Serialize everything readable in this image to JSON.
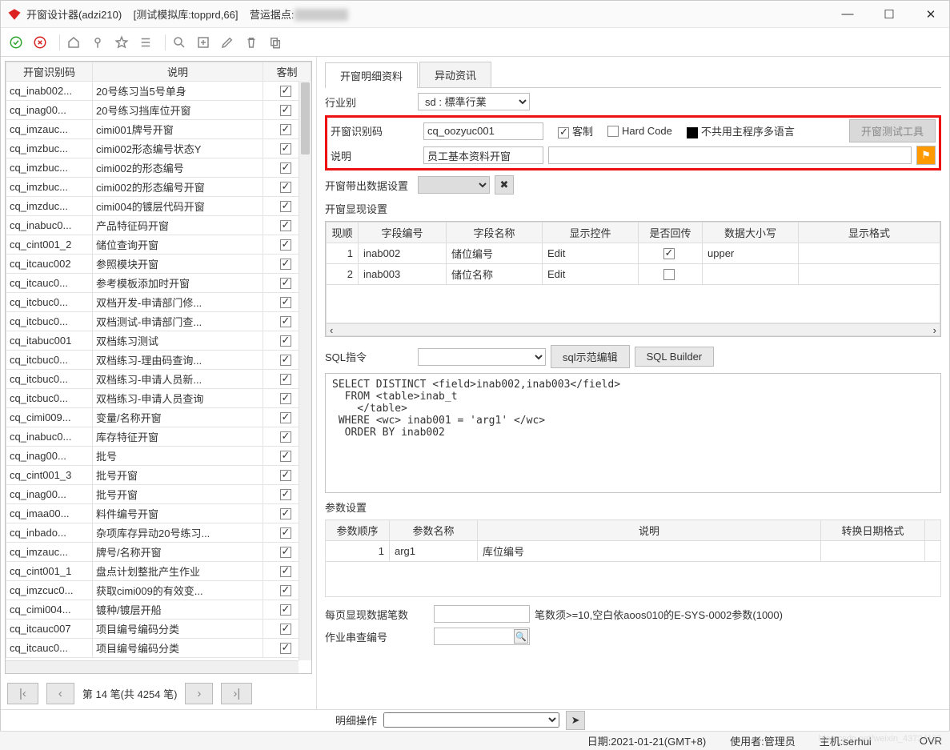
{
  "title": {
    "app": "开窗设计器(adzi210)",
    "env": "[测试模拟库:topprd,66]",
    "site_label": "营运据点:",
    "site_value": "██████"
  },
  "win_controls": {
    "min": "—",
    "max": "☐",
    "close": "✕"
  },
  "left_headers": {
    "code": "开窗识别码",
    "desc": "说明",
    "cust": "客制"
  },
  "left_rows": [
    {
      "code": "cq_inab002...",
      "desc": "20号练习当5号单身",
      "chk": true
    },
    {
      "code": "cq_inag00...",
      "desc": "20号练习挡库位开窗",
      "chk": true
    },
    {
      "code": "cq_imzauc...",
      "desc": "cimi001牌号开窗",
      "chk": true
    },
    {
      "code": "cq_imzbuc...",
      "desc": "cimi002形态编号状态Y",
      "chk": true
    },
    {
      "code": "cq_imzbuc...",
      "desc": "cimi002的形态编号",
      "chk": true
    },
    {
      "code": "cq_imzbuc...",
      "desc": "cimi002的形态编号开窗",
      "chk": true
    },
    {
      "code": "cq_imzduc...",
      "desc": "cimi004的镀层代码开窗",
      "chk": true
    },
    {
      "code": "cq_inabuc0...",
      "desc": "产品特征码开窗",
      "chk": true
    },
    {
      "code": "cq_cint001_2",
      "desc": "储位查询开窗",
      "chk": true
    },
    {
      "code": "cq_itcauc002",
      "desc": "参照模块开窗",
      "chk": true
    },
    {
      "code": "cq_itcauc0...",
      "desc": "参考模板添加时开窗",
      "chk": true
    },
    {
      "code": "cq_itcbuc0...",
      "desc": "双档开发-申请部门修...",
      "chk": true
    },
    {
      "code": "cq_itcbuc0...",
      "desc": "双档测试-申请部门查...",
      "chk": true
    },
    {
      "code": "cq_itabuc001",
      "desc": "双档练习测试",
      "chk": true
    },
    {
      "code": "cq_itcbuc0...",
      "desc": "双档练习-理由码查询...",
      "chk": true
    },
    {
      "code": "cq_itcbuc0...",
      "desc": "双档练习-申请人员新...",
      "chk": true
    },
    {
      "code": "cq_itcbuc0...",
      "desc": "双档练习-申请人员查询",
      "chk": true
    },
    {
      "code": "cq_cimi009...",
      "desc": "变量/名称开窗",
      "chk": true
    },
    {
      "code": "cq_inabuc0...",
      "desc": "库存特征开窗",
      "chk": true
    },
    {
      "code": "cq_inag00...",
      "desc": "批号",
      "chk": true
    },
    {
      "code": "cq_cint001_3",
      "desc": "批号开窗",
      "chk": true
    },
    {
      "code": "cq_inag00...",
      "desc": "批号开窗",
      "chk": true
    },
    {
      "code": "cq_imaa00...",
      "desc": "料件编号开窗",
      "chk": true
    },
    {
      "code": "cq_inbado...",
      "desc": "杂项库存异动20号练习...",
      "chk": true
    },
    {
      "code": "cq_imzauc...",
      "desc": "牌号/名称开窗",
      "chk": true
    },
    {
      "code": "cq_cint001_1",
      "desc": "盘点计划整批产生作业",
      "chk": true
    },
    {
      "code": "cq_imzcuc0...",
      "desc": "获取cimi009的有效变...",
      "chk": true
    },
    {
      "code": "cq_cimi004...",
      "desc": "镀种/镀层开船",
      "chk": true
    },
    {
      "code": "cq_itcauc007",
      "desc": "项目编号编码分类",
      "chk": true
    },
    {
      "code": "cq_itcauc0...",
      "desc": "项目编号编码分类",
      "chk": true
    }
  ],
  "pager": {
    "text": "第 14 笔(共 4254 笔)",
    "first": "|‹",
    "prev": "‹",
    "next": "›",
    "last": "›|"
  },
  "tabs": {
    "tab1": "开窗明细资料",
    "tab2": "异动资讯"
  },
  "form": {
    "industry_label": "行业别",
    "industry_value": "sd : 標準行業",
    "id_label": "开窗识别码",
    "id_value": "cq_oozyuc001",
    "cust_label": "客制",
    "hardcode_label": "Hard Code",
    "nolang_label": "不共用主程序多语言",
    "test_btn": "开窗测试工具",
    "desc_label": "说明",
    "desc_value": "员工基本资料开窗",
    "export_cfg_label": "开窗带出数据设置",
    "display_cfg_label": "开窗显现设置"
  },
  "field_grid": {
    "headers": {
      "order": "现顺",
      "code": "字段编号",
      "name": "字段名称",
      "widget": "显示控件",
      "return": "是否回传",
      "case": "数据大小写",
      "fmt": "显示格式"
    },
    "rows": [
      {
        "order": "1",
        "code": "inab002",
        "name": "储位编号",
        "widget": "Edit",
        "return": true,
        "case": "upper",
        "fmt": ""
      },
      {
        "order": "2",
        "code": "inab003",
        "name": "储位名称",
        "widget": "Edit",
        "return": false,
        "case": "",
        "fmt": ""
      }
    ]
  },
  "sql": {
    "label": "SQL指令",
    "sample_btn": "sql示范编辑",
    "builder_btn": "SQL Builder",
    "text": "SELECT DISTINCT <field>inab002,inab003</field>\n  FROM <table>inab_t\n    </table>\n WHERE <wc> inab001 = 'arg1' </wc>\n  ORDER BY inab002"
  },
  "params": {
    "label": "参数设置",
    "headers": {
      "order": "参数顺序",
      "name": "参数名称",
      "desc": "说明",
      "datefmt": "转换日期格式"
    },
    "rows": [
      {
        "order": "1",
        "name": "arg1",
        "desc": "库位编号",
        "datefmt": ""
      }
    ]
  },
  "paging_cfg": {
    "label": "每页显现数据笔数",
    "hint": "笔数须>=10,空白依aoos010的E-SYS-0002参数(1000)"
  },
  "job_label": "作业串查编号",
  "detail_op_label": "明细操作",
  "status": {
    "date": "日期:2021-01-21(GMT+8)",
    "user": "使用者:管理员",
    "host": "主机:serhui",
    "ovr": "OVR",
    "watermark": "blog.csdn.net/weixin_43724195"
  }
}
